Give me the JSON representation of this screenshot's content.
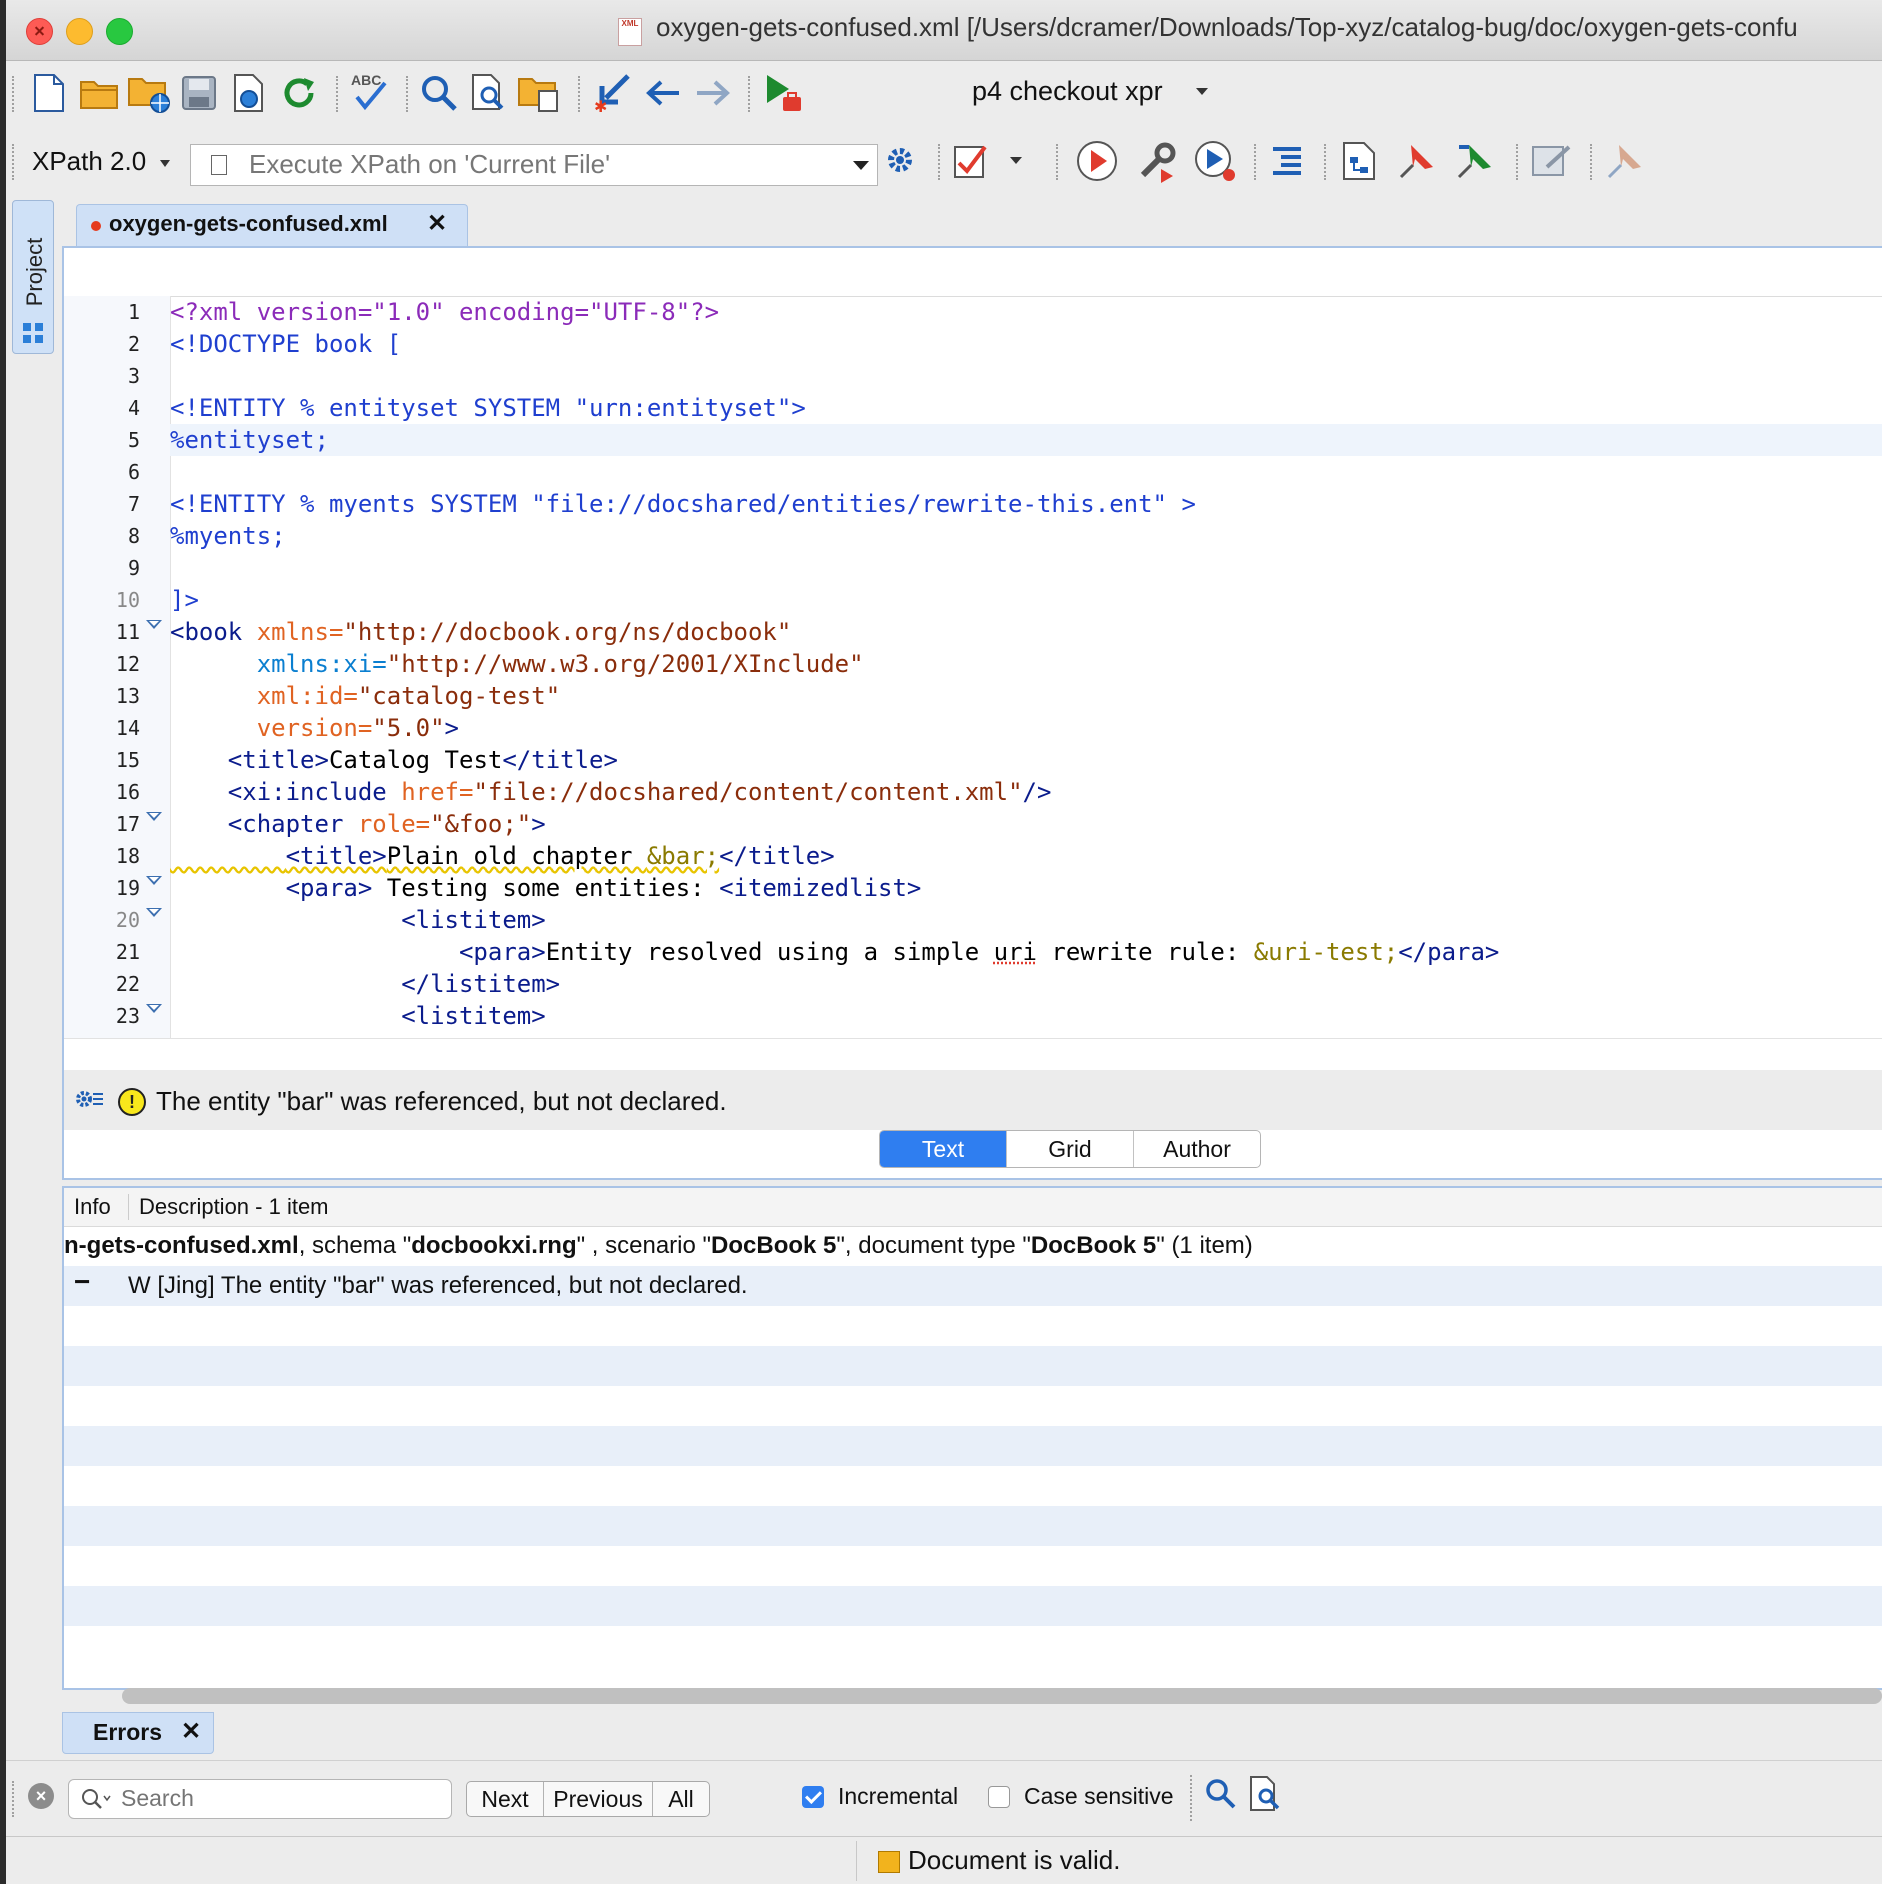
{
  "window": {
    "title": "oxygen-gets-confused.xml [/Users/dcramer/Downloads/Top-xyz/catalog-bug/doc/oxygen-gets-confu"
  },
  "toolbar1": {
    "icons": [
      "new-file-icon",
      "open-folder-icon",
      "open-url-icon",
      "save-icon",
      "save-to-url-icon",
      "reload-icon",
      "spellcheck-icon",
      "find-icon",
      "find-in-files-icon",
      "paste-icon",
      "last-edit-icon",
      "back-icon",
      "forward-icon",
      "run-icon"
    ],
    "spellcheck_label": "ABC",
    "p4_label": "p4 checkout xpr"
  },
  "toolbar2": {
    "xpath_version": "XPath 2.0",
    "xpath_placeholder": "Execute XPath on  'Current File'"
  },
  "sidebar": {
    "project_label": "Project"
  },
  "editor": {
    "tab_label": "oxygen-gets-confused.xml",
    "tab_close": "✕",
    "lines": [
      {
        "num": "1"
      },
      {
        "num": "2"
      },
      {
        "num": "3"
      },
      {
        "num": "4"
      },
      {
        "num": "5"
      },
      {
        "num": "6"
      },
      {
        "num": "7"
      },
      {
        "num": "8"
      },
      {
        "num": "9"
      },
      {
        "num": "10"
      },
      {
        "num": "11"
      },
      {
        "num": "12"
      },
      {
        "num": "13"
      },
      {
        "num": "14"
      },
      {
        "num": "15"
      },
      {
        "num": "16"
      },
      {
        "num": "17"
      },
      {
        "num": "18"
      },
      {
        "num": "19"
      },
      {
        "num": "20"
      },
      {
        "num": "21"
      },
      {
        "num": "22"
      },
      {
        "num": "23"
      }
    ],
    "code": {
      "l1": "<?xml version=\"1.0\" encoding=\"UTF-8\"?>",
      "l2": "<!DOCTYPE book [",
      "l4": "<!ENTITY % entityset SYSTEM \"urn:entityset\">",
      "l5": "%entityset;",
      "l7": "<!ENTITY % myents SYSTEM \"file://docshared/entities/rewrite-this.ent\" >",
      "l8": "%myents;",
      "l10": "]>",
      "l11_tag": "<book",
      "l11_attr": " xmlns=",
      "l11_val": "\"http://docbook.org/ns/docbook\"",
      "l12_indent": "      ",
      "l12_attr": "xmlns:xi=",
      "l12_val": "\"http://www.w3.org/2001/XInclude\"",
      "l13_indent": "      ",
      "l13_attr": "xml:id=",
      "l13_val": "\"catalog-test\"",
      "l14_indent": "      ",
      "l14_attr": "version=",
      "l14_val": "\"5.0\"",
      "l14_end": ">",
      "l15_indent": "    ",
      "l15_open": "<title>",
      "l15_text": "Catalog Test",
      "l15_close": "</title>",
      "l16_indent": "    ",
      "l16_tag": "<xi:include",
      "l16_attr": " href=",
      "l16_val": "\"file://docshared/content/content.xml\"",
      "l16_end": "/>",
      "l17_indent": "    ",
      "l17_tag": "<chapter",
      "l17_attr": " role=",
      "l17_val": "\"&foo;\"",
      "l17_end": ">",
      "l18_indent": "        ",
      "l18_open": "<title>",
      "l18_text": "Plain old chapter ",
      "l18_ent": "&bar;",
      "l18_close": "</title>",
      "l19_indent": "        ",
      "l19_open": "<para>",
      "l19_text": " Testing some entities: ",
      "l19_tag2": "<itemizedlist>",
      "l20_indent": "                ",
      "l20_tag": "<listitem>",
      "l21_indent": "                    ",
      "l21_open": "<para>",
      "l21_text1": "Entity resolved using a simple ",
      "l21_text2": "uri",
      "l21_text3": " rewrite rule: ",
      "l21_ent": "&uri-test;",
      "l21_close": "</para>",
      "l22_indent": "                ",
      "l22_tag": "</listitem>",
      "l23_indent": "                ",
      "l23_tag": "<listitem>"
    },
    "problem": "The entity \"bar\" was referenced, but not declared.",
    "modes": [
      "Text",
      "Grid",
      "Author"
    ],
    "active_mode": "Text"
  },
  "results": {
    "col_info": "Info",
    "col_desc": "Description - 1 item",
    "group": {
      "file": "n-gets-confused.xml",
      "t1": ", schema \"",
      "schema": "docbookxi.rng",
      "t2": "\" , scenario \"",
      "scenario": "DocBook 5",
      "t3": "\", document type \"",
      "doctype": "DocBook 5",
      "t4": "\" (1 item)"
    },
    "issue_mark": "−",
    "issue_text": "W [Jing] The entity \"bar\" was referenced, but not declared."
  },
  "errors_tab": {
    "label": "Errors",
    "close": "✕"
  },
  "findbar": {
    "search_placeholder": "Search",
    "next": "Next",
    "previous": "Previous",
    "all": "All",
    "incremental": "Incremental",
    "incremental_checked": true,
    "case_sensitive": "Case sensitive",
    "case_checked": false
  },
  "status": {
    "text": "Document is valid."
  },
  "colors": {
    "accent": "#2f7ef0",
    "tab_bg": "#cfe0f6",
    "warning": "#f8e71c",
    "status_square": "#f2b31d"
  }
}
